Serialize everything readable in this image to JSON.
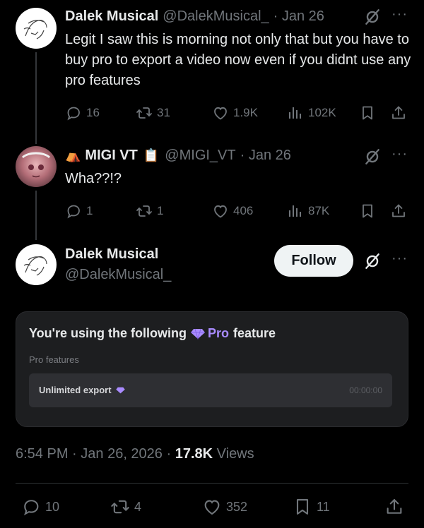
{
  "tweet1": {
    "name": "Dalek Musical",
    "handle": "@DalekMusical_",
    "date": "· Jan 26",
    "text": "Legit I saw this is morning not only that but you have to buy pro to export a video now even if you didnt use any pro features",
    "replies": "16",
    "reposts": "31",
    "likes": "1.9K",
    "views": "102K"
  },
  "tweet2": {
    "name": "MIGI VT",
    "handle": "@MIGI_VT",
    "date": "· Jan 26",
    "text": "Wha??!?",
    "replies": "1",
    "reposts": "1",
    "likes": "406",
    "views": "87K"
  },
  "main": {
    "name": "Dalek Musical",
    "handle": "@DalekMusical_",
    "follow_label": "Follow",
    "card": {
      "title_prefix": "You're using the following",
      "title_pro": "Pro",
      "title_suffix": "feature",
      "subtitle": "Pro features",
      "row_label": "Unlimited export",
      "row_time": "00:00:00"
    },
    "time": "6:54 PM",
    "date": "Jan 26, 2026",
    "views_count": "17.8K",
    "views_label": "Views",
    "replies": "10",
    "reposts": "4",
    "likes": "352",
    "bookmarks": "11"
  },
  "colors": {
    "background": "#000000",
    "text": "#e7e9ea",
    "muted": "#71767b",
    "pro_accent": "#a98bff"
  },
  "icons": [
    "reply-icon",
    "repost-icon",
    "like-icon",
    "views-icon",
    "bookmark-icon",
    "share-icon",
    "grok-icon",
    "more-icon",
    "diamond-icon"
  ]
}
